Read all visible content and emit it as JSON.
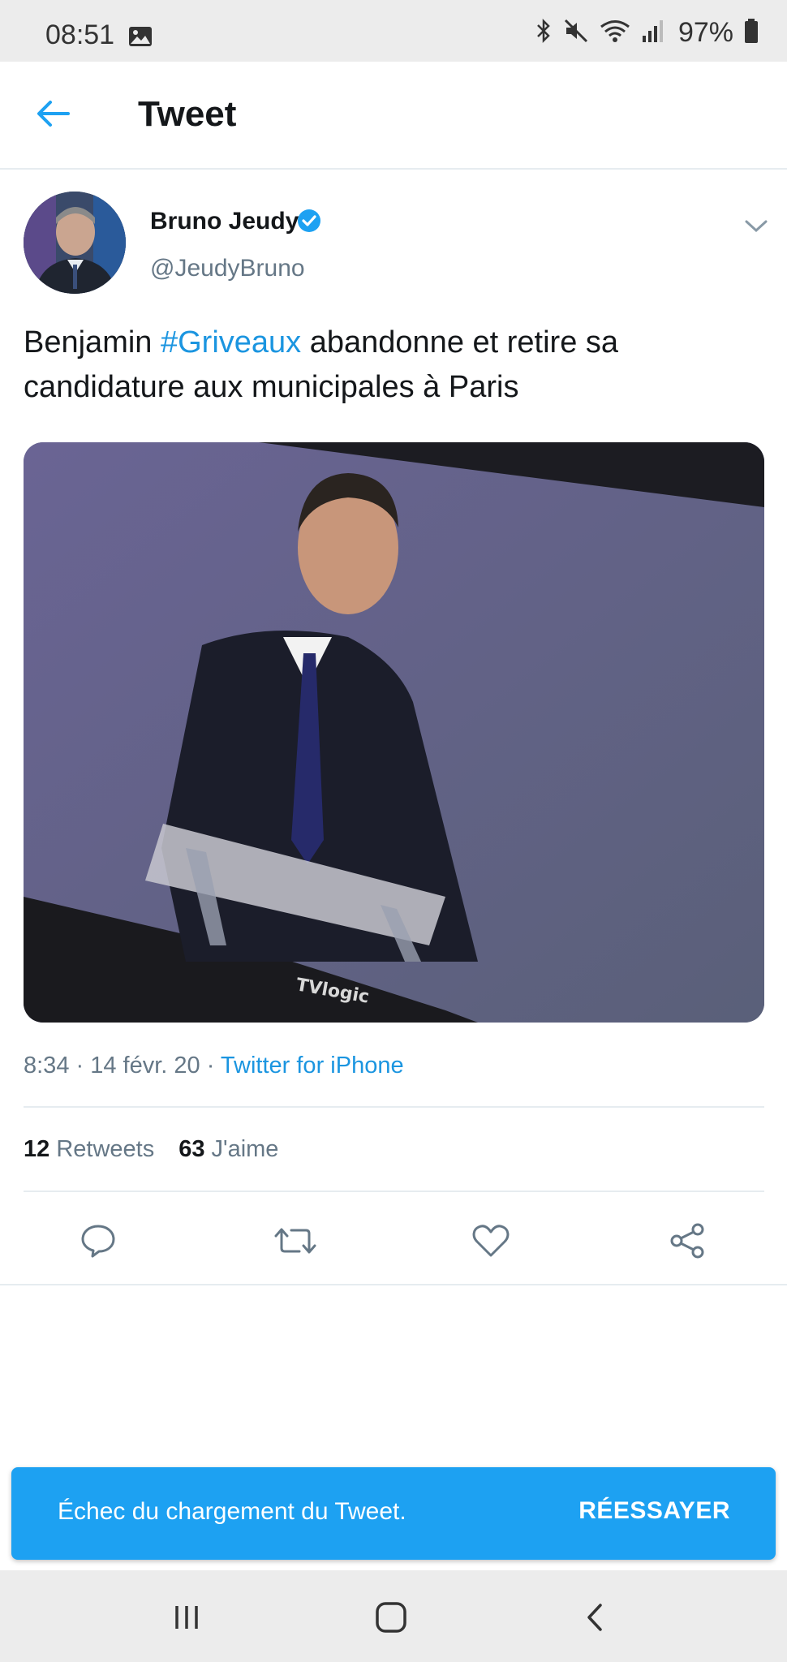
{
  "status_bar": {
    "time": "08:51",
    "battery": "97%",
    "icons": [
      "gallery-icon",
      "bluetooth-icon",
      "mute-icon",
      "wifi-icon",
      "signal-icon",
      "battery-icon"
    ]
  },
  "app_bar": {
    "title": "Tweet",
    "back_icon": "back-arrow-icon"
  },
  "tweet": {
    "author_name": "Bruno Jeudy",
    "handle": "@JeudyBruno",
    "verified": true,
    "text_before": "Benjamin ",
    "hashtag": "#Griveaux",
    "text_after": " abandonne et retire sa candidature aux municipales à Paris",
    "time": "8:34",
    "date": "14 févr. 20",
    "source": "Twitter for iPhone",
    "separator": " · ",
    "retweets_count": "12",
    "retweets_label": "Retweets",
    "likes_count": "63",
    "likes_label": "J'aime",
    "media_text": "TVlogic"
  },
  "actions": [
    "reply-icon",
    "retweet-icon",
    "like-icon",
    "share-icon"
  ],
  "toast": {
    "message": "Échec du chargement du Tweet.",
    "action_label": "RÉESSAYER"
  },
  "colors": {
    "accent": "#1da1f2",
    "link": "#1b95e0",
    "secondary_text": "#657786",
    "divider": "#e6ecf0"
  }
}
